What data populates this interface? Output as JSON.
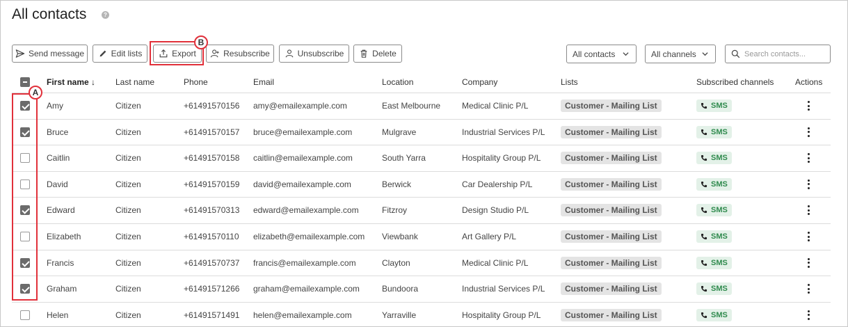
{
  "page": {
    "title": "All contacts",
    "help_icon": "question-mark-icon"
  },
  "toolbar": {
    "send_message": "Send message",
    "edit_lists": "Edit lists",
    "export": "Export",
    "resubscribe": "Resubscribe",
    "unsubscribe": "Unsubscribe",
    "delete": "Delete"
  },
  "filters": {
    "contacts_filter": "All contacts",
    "channels_filter": "All channels",
    "search_placeholder": "Search contacts..."
  },
  "annotations": {
    "a": "A",
    "b": "B",
    "highlight_color": "#e1303a"
  },
  "table": {
    "headers": {
      "first_name": "First name ↓",
      "last_name": "Last name",
      "phone": "Phone",
      "email": "Email",
      "location": "Location",
      "company": "Company",
      "lists": "Lists",
      "subscribed_channels": "Subscribed channels",
      "actions": "Actions"
    },
    "rows": [
      {
        "checked": true,
        "first_name": "Amy",
        "last_name": "Citizen",
        "phone": "+61491570156",
        "email": "amy@emailexample.com",
        "location": "East Melbourne",
        "company": "Medical Clinic P/L",
        "list": "Customer - Mailing List",
        "channel": "SMS"
      },
      {
        "checked": true,
        "first_name": "Bruce",
        "last_name": "Citizen",
        "phone": "+61491570157",
        "email": "bruce@emailexample.com",
        "location": "Mulgrave",
        "company": "Industrial Services P/L",
        "list": "Customer - Mailing List",
        "channel": "SMS"
      },
      {
        "checked": false,
        "first_name": "Caitlin",
        "last_name": "Citizen",
        "phone": "+61491570158",
        "email": "caitlin@emailexample.com",
        "location": "South Yarra",
        "company": "Hospitality Group P/L",
        "list": "Customer - Mailing List",
        "channel": "SMS"
      },
      {
        "checked": false,
        "first_name": "David",
        "last_name": "Citizen",
        "phone": "+61491570159",
        "email": "david@emailexample.com",
        "location": "Berwick",
        "company": "Car Dealership P/L",
        "list": "Customer - Mailing List",
        "channel": "SMS"
      },
      {
        "checked": true,
        "first_name": "Edward",
        "last_name": "Citizen",
        "phone": "+61491570313",
        "email": "edward@emailexample.com",
        "location": "Fitzroy",
        "company": "Design Studio P/L",
        "list": "Customer - Mailing List",
        "channel": "SMS"
      },
      {
        "checked": false,
        "first_name": "Elizabeth",
        "last_name": "Citizen",
        "phone": "+61491570110",
        "email": "elizabeth@emailexample.com",
        "location": "Viewbank",
        "company": "Art Gallery P/L",
        "list": "Customer - Mailing List",
        "channel": "SMS"
      },
      {
        "checked": true,
        "first_name": "Francis",
        "last_name": "Citizen",
        "phone": "+61491570737",
        "email": "francis@emailexample.com",
        "location": "Clayton",
        "company": "Medical Clinic P/L",
        "list": "Customer - Mailing List",
        "channel": "SMS"
      },
      {
        "checked": true,
        "first_name": "Graham",
        "last_name": "Citizen",
        "phone": "+61491571266",
        "email": "graham@emailexample.com",
        "location": "Bundoora",
        "company": "Industrial Services P/L",
        "list": "Customer - Mailing List",
        "channel": "SMS"
      },
      {
        "checked": false,
        "first_name": "Helen",
        "last_name": "Citizen",
        "phone": "+61491571491",
        "email": "helen@emailexample.com",
        "location": "Yarraville",
        "company": "Hospitality Group P/L",
        "list": "Customer - Mailing List",
        "channel": "SMS"
      }
    ]
  },
  "colors": {
    "sms_text": "#2f8a4d",
    "sms_bg": "#e3f1e8",
    "list_bg": "#e4e4e4",
    "checkbox_checked": "#6b6b6b"
  }
}
